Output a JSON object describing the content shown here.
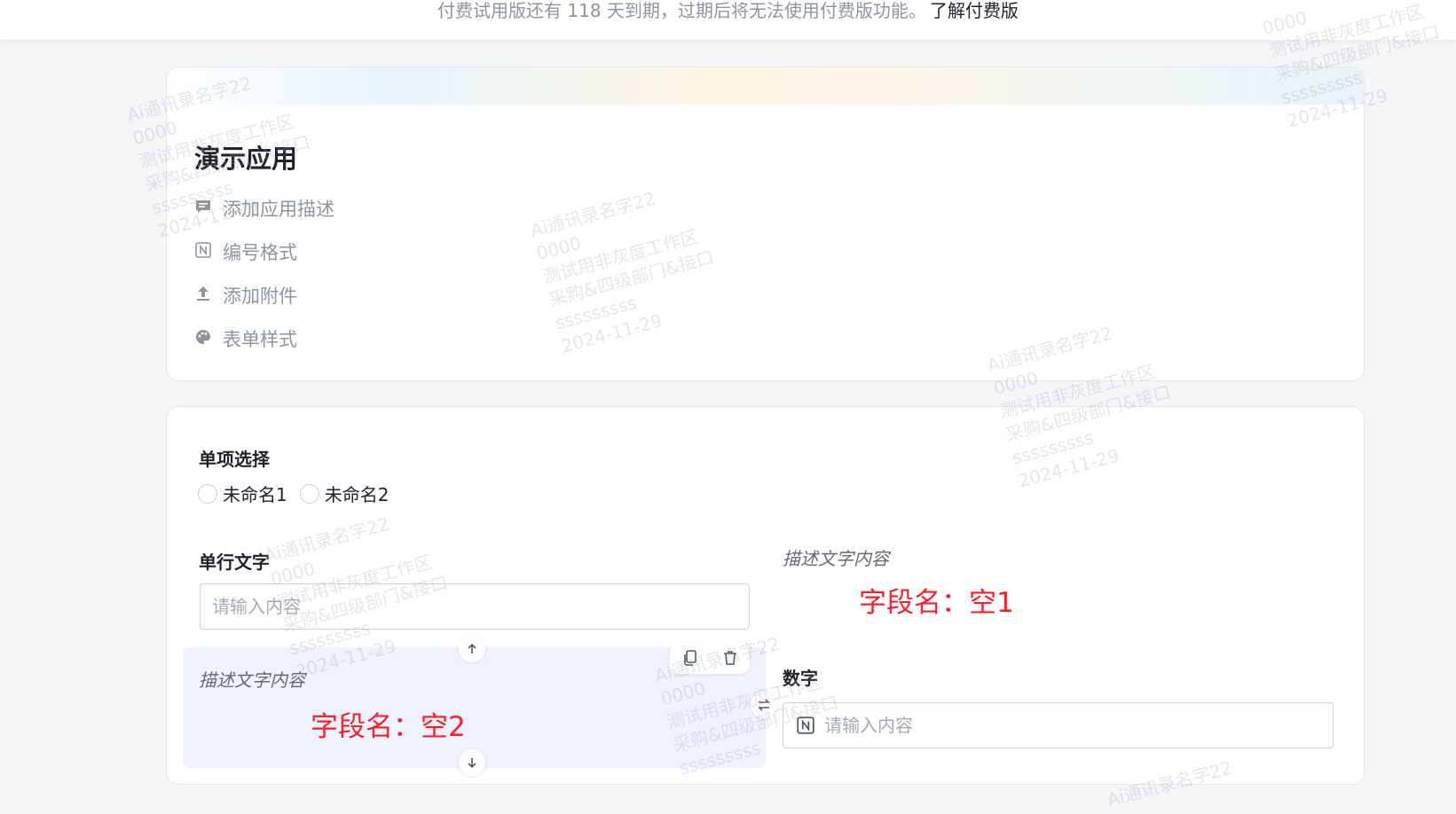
{
  "banner": {
    "text": "付费试用版还有 118 天到期，过期后将无法使用付费版功能。",
    "link": "了解付费版"
  },
  "app": {
    "title": "演示应用",
    "menu": [
      {
        "label": "添加应用描述",
        "icon": "comment-icon"
      },
      {
        "label": "编号格式",
        "icon": "number-format-icon"
      },
      {
        "label": "添加附件",
        "icon": "upload-icon"
      },
      {
        "label": "表单样式",
        "icon": "palette-icon"
      }
    ]
  },
  "form": {
    "radio": {
      "label": "单项选择",
      "options": [
        "未命名1",
        "未命名2"
      ]
    },
    "single_text": {
      "label": "单行文字",
      "placeholder": "请输入内容"
    },
    "desc_block_left": {
      "text": "描述文字内容",
      "field_name": "字段名：空2"
    },
    "desc_block_right": {
      "text": "描述文字内容",
      "field_name": "字段名：空1"
    },
    "number": {
      "label": "数字",
      "placeholder": "请输入内容"
    }
  },
  "watermark": {
    "lines": [
      "Ai通讯录名字22",
      "0000",
      "测试用非灰度工作区",
      "采购&四级部门&接口",
      "sssssssss",
      "2024-11-29"
    ]
  },
  "colors": {
    "field_name_red": "#f5222d",
    "selected_block_bg": "#eef3ff"
  }
}
